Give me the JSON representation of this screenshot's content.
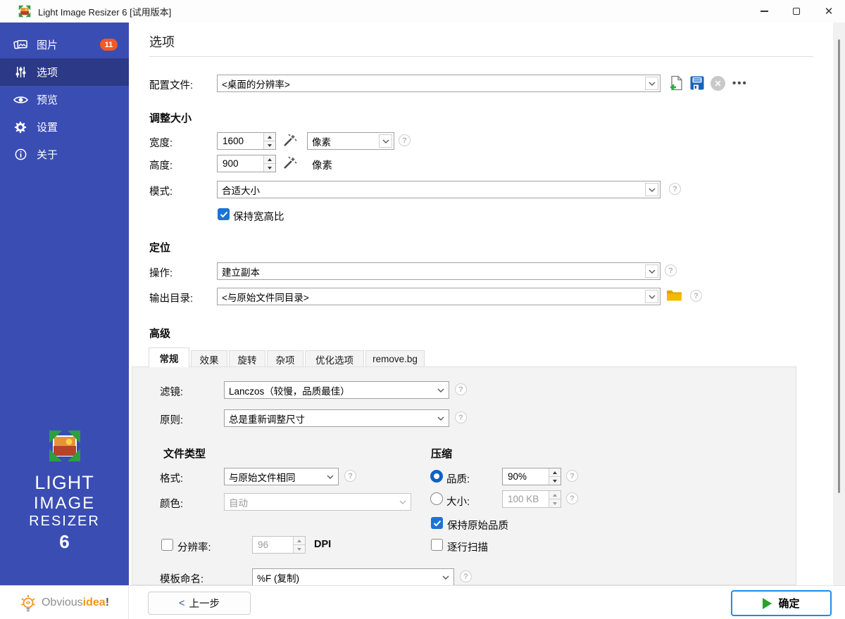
{
  "window": {
    "title": "Light Image Resizer 6  [试用版本]"
  },
  "sidebar": {
    "items": [
      {
        "label": "图片",
        "icon": "images-icon",
        "badge": "11"
      },
      {
        "label": "选项",
        "icon": "sliders-icon"
      },
      {
        "label": "预览",
        "icon": "eye-icon"
      },
      {
        "label": "设置",
        "icon": "gear-icon"
      },
      {
        "label": "关于",
        "icon": "info-icon"
      }
    ],
    "logo": {
      "line1": "LIGHT",
      "line2": "IMAGE",
      "line3": "RESIZER",
      "version": "6"
    }
  },
  "brand": {
    "prefix": "Obvious",
    "highlight": "idea",
    "suffix": "!"
  },
  "page": {
    "title": "选项"
  },
  "profile": {
    "label": "配置文件:",
    "value": "<桌面的分辨率>",
    "more_glyph": "•••",
    "clear_glyph": "✕"
  },
  "resize": {
    "header": "调整大小",
    "width_label": "宽度:",
    "width_value": "1600",
    "height_label": "高度:",
    "height_value": "900",
    "unit_select_value": "像素",
    "unit_text": "像素",
    "mode_label": "模式:",
    "mode_value": "合适大小",
    "keep_ratio_label": "保持宽高比",
    "keep_ratio_checked": true
  },
  "destination": {
    "header": "定位",
    "action_label": "操作:",
    "action_value": "建立副本",
    "output_label": "输出目录:",
    "output_value": "<与原始文件同目录>"
  },
  "advanced": {
    "header": "高级",
    "tabs": [
      {
        "label": "常规",
        "active": true
      },
      {
        "label": "效果",
        "active": false
      },
      {
        "label": "旋转",
        "active": false
      },
      {
        "label": "杂项",
        "active": false
      },
      {
        "label": "优化选项",
        "active": false
      },
      {
        "label": "remove.bg",
        "active": false
      }
    ],
    "filter_label": "滤镜:",
    "filter_value": "Lanczos（较慢，品质最佳）",
    "policy_label": "原则:",
    "policy_value": "总是重新调整尺寸",
    "filetype": {
      "header": "文件类型",
      "format_label": "格式:",
      "format_value": "与原始文件相同",
      "color_label": "颜色:",
      "color_value": "自动",
      "color_disabled": true
    },
    "compression": {
      "header": "压缩",
      "quality_label": "品质:",
      "quality_value": "90%",
      "quality_selected": true,
      "size_label": "大小:",
      "size_value": "100 KB",
      "size_selected": false,
      "keep_quality_label": "保持原始品质",
      "keep_quality_checked": true,
      "progressive_label": "逐行扫描",
      "progressive_checked": false
    },
    "resolution": {
      "label": "分辨率:",
      "value": "96",
      "unit": "DPI",
      "checked": false
    },
    "template": {
      "label": "模板命名:",
      "value": "%F (复制)"
    }
  },
  "footer": {
    "back_label": "上一步",
    "back_arrow": "<",
    "ok_label": "确定"
  },
  "icons": {
    "help_glyph": "?"
  },
  "colors": {
    "sidebar": "#3a4db3",
    "sidebar_active": "#2b3987",
    "badge": "#f15a24",
    "checkbox": "#1b74d2",
    "radio": "#0d63c4",
    "ok_border": "#1b8ce8",
    "play_green": "#2ca02c",
    "brand_orange": "#f7941d",
    "folder": "#f6b800"
  }
}
